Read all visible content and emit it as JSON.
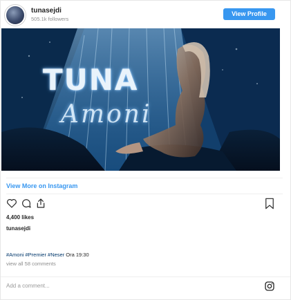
{
  "header": {
    "username": "tunasejdi",
    "followers": "505.1k followers",
    "view_profile_label": "View Profile"
  },
  "media": {
    "title_main": "TUNA",
    "title_sub": "Amoni"
  },
  "link": {
    "view_more_label": "View More on Instagram"
  },
  "post": {
    "likes": "4,400 likes",
    "caption_user": "tunasejdi",
    "hashtags": "#Amoni #Premier #Neser",
    "caption_tail": " Ora 19:30",
    "view_all_comments": "view all 58 comments",
    "comment_placeholder": "Add a comment..."
  },
  "colors": {
    "accent": "#3897f0",
    "link": "#3897f0",
    "hashtag": "#00376b",
    "muted": "#8e8e8e"
  },
  "icons": [
    "avatar",
    "heart-icon",
    "comment-icon",
    "share-icon",
    "bookmark-icon",
    "instagram-icon"
  ]
}
